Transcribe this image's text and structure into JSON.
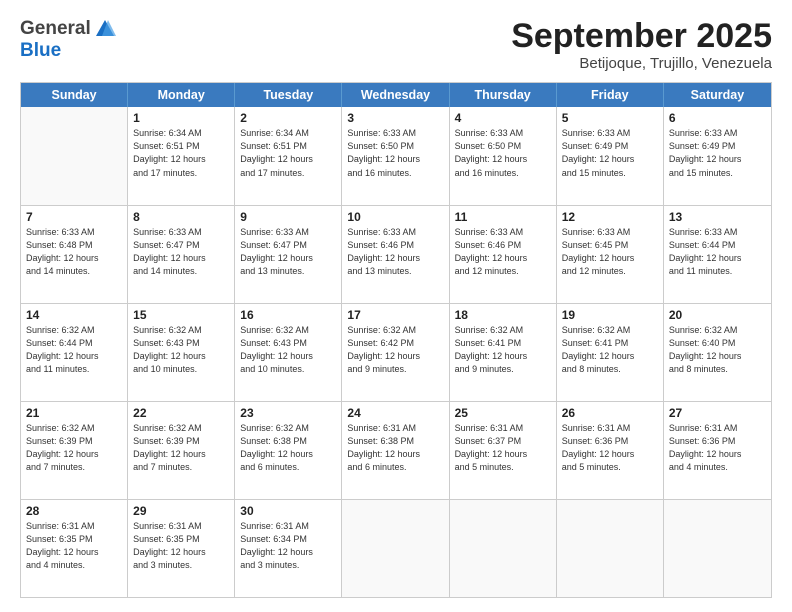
{
  "header": {
    "logo": {
      "general": "General",
      "blue": "Blue",
      "tagline": ""
    },
    "title": "September 2025",
    "subtitle": "Betijoque, Trujillo, Venezuela"
  },
  "calendar": {
    "weekdays": [
      "Sunday",
      "Monday",
      "Tuesday",
      "Wednesday",
      "Thursday",
      "Friday",
      "Saturday"
    ],
    "rows": [
      [
        {
          "day": "",
          "text": ""
        },
        {
          "day": "1",
          "text": "Sunrise: 6:34 AM\nSunset: 6:51 PM\nDaylight: 12 hours\nand 17 minutes."
        },
        {
          "day": "2",
          "text": "Sunrise: 6:34 AM\nSunset: 6:51 PM\nDaylight: 12 hours\nand 17 minutes."
        },
        {
          "day": "3",
          "text": "Sunrise: 6:33 AM\nSunset: 6:50 PM\nDaylight: 12 hours\nand 16 minutes."
        },
        {
          "day": "4",
          "text": "Sunrise: 6:33 AM\nSunset: 6:50 PM\nDaylight: 12 hours\nand 16 minutes."
        },
        {
          "day": "5",
          "text": "Sunrise: 6:33 AM\nSunset: 6:49 PM\nDaylight: 12 hours\nand 15 minutes."
        },
        {
          "day": "6",
          "text": "Sunrise: 6:33 AM\nSunset: 6:49 PM\nDaylight: 12 hours\nand 15 minutes."
        }
      ],
      [
        {
          "day": "7",
          "text": "Sunrise: 6:33 AM\nSunset: 6:48 PM\nDaylight: 12 hours\nand 14 minutes."
        },
        {
          "day": "8",
          "text": "Sunrise: 6:33 AM\nSunset: 6:47 PM\nDaylight: 12 hours\nand 14 minutes."
        },
        {
          "day": "9",
          "text": "Sunrise: 6:33 AM\nSunset: 6:47 PM\nDaylight: 12 hours\nand 13 minutes."
        },
        {
          "day": "10",
          "text": "Sunrise: 6:33 AM\nSunset: 6:46 PM\nDaylight: 12 hours\nand 13 minutes."
        },
        {
          "day": "11",
          "text": "Sunrise: 6:33 AM\nSunset: 6:46 PM\nDaylight: 12 hours\nand 12 minutes."
        },
        {
          "day": "12",
          "text": "Sunrise: 6:33 AM\nSunset: 6:45 PM\nDaylight: 12 hours\nand 12 minutes."
        },
        {
          "day": "13",
          "text": "Sunrise: 6:33 AM\nSunset: 6:44 PM\nDaylight: 12 hours\nand 11 minutes."
        }
      ],
      [
        {
          "day": "14",
          "text": "Sunrise: 6:32 AM\nSunset: 6:44 PM\nDaylight: 12 hours\nand 11 minutes."
        },
        {
          "day": "15",
          "text": "Sunrise: 6:32 AM\nSunset: 6:43 PM\nDaylight: 12 hours\nand 10 minutes."
        },
        {
          "day": "16",
          "text": "Sunrise: 6:32 AM\nSunset: 6:43 PM\nDaylight: 12 hours\nand 10 minutes."
        },
        {
          "day": "17",
          "text": "Sunrise: 6:32 AM\nSunset: 6:42 PM\nDaylight: 12 hours\nand 9 minutes."
        },
        {
          "day": "18",
          "text": "Sunrise: 6:32 AM\nSunset: 6:41 PM\nDaylight: 12 hours\nand 9 minutes."
        },
        {
          "day": "19",
          "text": "Sunrise: 6:32 AM\nSunset: 6:41 PM\nDaylight: 12 hours\nand 8 minutes."
        },
        {
          "day": "20",
          "text": "Sunrise: 6:32 AM\nSunset: 6:40 PM\nDaylight: 12 hours\nand 8 minutes."
        }
      ],
      [
        {
          "day": "21",
          "text": "Sunrise: 6:32 AM\nSunset: 6:39 PM\nDaylight: 12 hours\nand 7 minutes."
        },
        {
          "day": "22",
          "text": "Sunrise: 6:32 AM\nSunset: 6:39 PM\nDaylight: 12 hours\nand 7 minutes."
        },
        {
          "day": "23",
          "text": "Sunrise: 6:32 AM\nSunset: 6:38 PM\nDaylight: 12 hours\nand 6 minutes."
        },
        {
          "day": "24",
          "text": "Sunrise: 6:31 AM\nSunset: 6:38 PM\nDaylight: 12 hours\nand 6 minutes."
        },
        {
          "day": "25",
          "text": "Sunrise: 6:31 AM\nSunset: 6:37 PM\nDaylight: 12 hours\nand 5 minutes."
        },
        {
          "day": "26",
          "text": "Sunrise: 6:31 AM\nSunset: 6:36 PM\nDaylight: 12 hours\nand 5 minutes."
        },
        {
          "day": "27",
          "text": "Sunrise: 6:31 AM\nSunset: 6:36 PM\nDaylight: 12 hours\nand 4 minutes."
        }
      ],
      [
        {
          "day": "28",
          "text": "Sunrise: 6:31 AM\nSunset: 6:35 PM\nDaylight: 12 hours\nand 4 minutes."
        },
        {
          "day": "29",
          "text": "Sunrise: 6:31 AM\nSunset: 6:35 PM\nDaylight: 12 hours\nand 3 minutes."
        },
        {
          "day": "30",
          "text": "Sunrise: 6:31 AM\nSunset: 6:34 PM\nDaylight: 12 hours\nand 3 minutes."
        },
        {
          "day": "",
          "text": ""
        },
        {
          "day": "",
          "text": ""
        },
        {
          "day": "",
          "text": ""
        },
        {
          "day": "",
          "text": ""
        }
      ]
    ]
  }
}
